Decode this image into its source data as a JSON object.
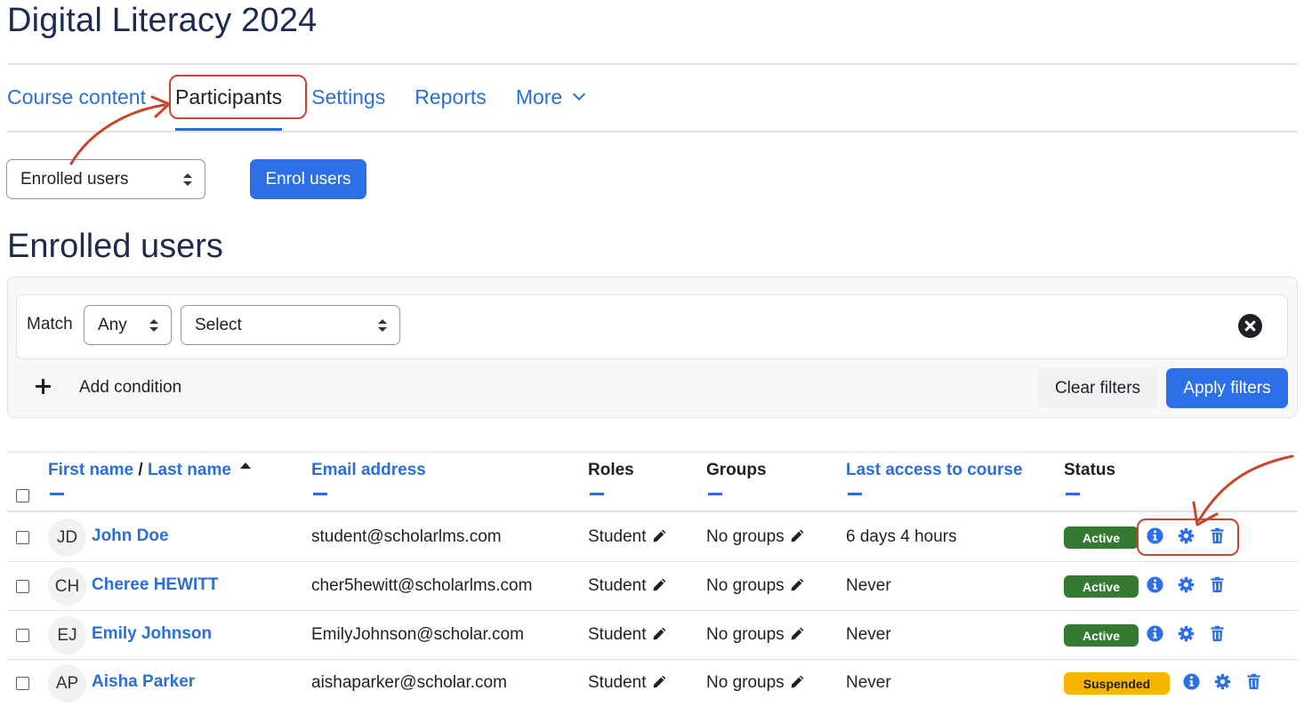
{
  "course": {
    "title": "Digital Literacy 2024"
  },
  "nav": {
    "tabs": [
      {
        "label": "Course content"
      },
      {
        "label": "Participants"
      },
      {
        "label": "Settings"
      },
      {
        "label": "Reports"
      },
      {
        "label": "More"
      }
    ],
    "active_tab": "Participants"
  },
  "toolbar": {
    "view_select": "Enrolled users",
    "enrol_button": "Enrol users"
  },
  "section": {
    "title": "Enrolled users"
  },
  "filters": {
    "match_label": "Match",
    "match_value": "Any",
    "condition_select": "Select",
    "add_condition": "Add condition",
    "clear_button": "Clear filters",
    "apply_button": "Apply filters"
  },
  "table": {
    "headers": {
      "first_name": "First name",
      "separator": "/",
      "last_name": "Last name",
      "email": "Email address",
      "roles": "Roles",
      "groups": "Groups",
      "last_access": "Last access to course",
      "status": "Status"
    },
    "rows": [
      {
        "initials": "JD",
        "name": "John Doe",
        "email": "student@scholarlms.com",
        "role": "Student",
        "groups": "No groups",
        "last_access": "6 days 4 hours",
        "status": "Active"
      },
      {
        "initials": "CH",
        "name": "Cheree HEWITT",
        "email": "cher5hewitt@scholarlms.com",
        "role": "Student",
        "groups": "No groups",
        "last_access": "Never",
        "status": "Active"
      },
      {
        "initials": "EJ",
        "name": "Emily Johnson",
        "email": "EmilyJohnson@scholar.com",
        "role": "Student",
        "groups": "No groups",
        "last_access": "Never",
        "status": "Active"
      },
      {
        "initials": "AP",
        "name": "Aisha Parker",
        "email": "aishaparker@scholar.com",
        "role": "Student",
        "groups": "No groups",
        "last_access": "Never",
        "status": "Suspended"
      }
    ]
  },
  "icons": {
    "edit": "pencil-icon",
    "info": "info-icon",
    "settings": "gear-icon",
    "delete": "trash-icon",
    "remove_condition": "close-circle-icon",
    "add": "plus-icon",
    "sort": "caret-up-icon",
    "more": "chevron-down-icon"
  },
  "colors": {
    "link": "#2a6fd8",
    "primary_button": "#2c6fe8",
    "active_badge": "#357a32",
    "suspended_badge": "#f7b500",
    "annotation": "#c6452b",
    "heading": "#1d2b4f"
  }
}
